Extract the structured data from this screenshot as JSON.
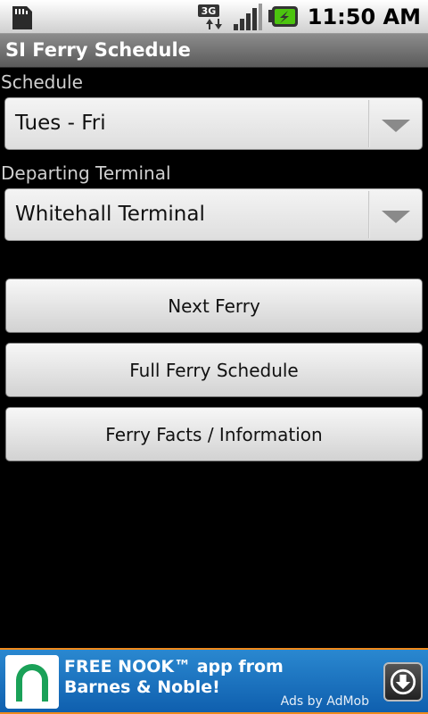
{
  "status_bar": {
    "time": "11:50 AM",
    "network_type": "3G",
    "icons": [
      "sd-card-icon",
      "network-3g-icon",
      "signal-strength-icon",
      "battery-charging-icon"
    ]
  },
  "app": {
    "title": "SI Ferry Schedule"
  },
  "form": {
    "schedule_label": "Schedule",
    "schedule_value": "Tues - Fri",
    "terminal_label": "Departing Terminal",
    "terminal_value": "Whitehall Terminal"
  },
  "buttons": {
    "next_ferry": "Next Ferry",
    "full_schedule": "Full Ferry Schedule",
    "facts": "Ferry Facts / Information"
  },
  "ad": {
    "line1": "FREE NOOK™ app from",
    "line2": "Barnes & Noble!",
    "attribution": "Ads by AdMob"
  },
  "colors": {
    "ad_background": "#1a70bf",
    "ad_border": "#f08a1c",
    "nook_green": "#1aa158"
  }
}
